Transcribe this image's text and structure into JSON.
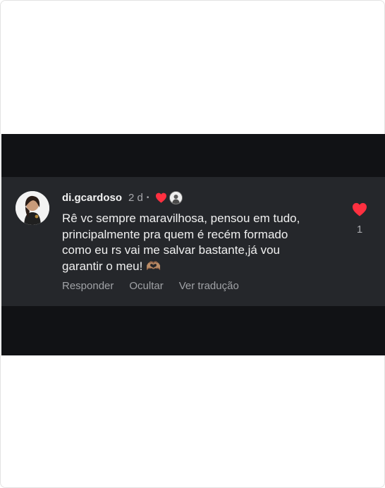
{
  "comment": {
    "username": "di.gcardoso",
    "time": "2 d",
    "separator": "•",
    "text": "Rê vc sempre maravilhosa, pensou em tudo,\nprincipalmente pra quem é recém formado\ncomo eu rs vai me  salvar bastante,já vou\ngarantir o meu! 🫶🏽",
    "like_count": "1",
    "liked": true
  },
  "actions": {
    "reply": "Responder",
    "hide": "Ocultar",
    "translate": "Ver tradução"
  },
  "colors": {
    "heart": "#ff3040",
    "panel": "#25272b",
    "background": "#111215"
  }
}
